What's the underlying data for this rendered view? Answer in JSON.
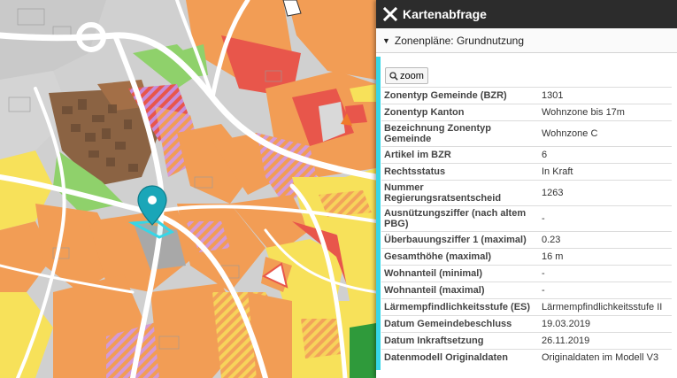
{
  "panel": {
    "title": "Kartenabfrage",
    "section_label": "Zonenpläne: Grundnutzung",
    "zoom_label": "zoom"
  },
  "attributes": [
    {
      "key": "Zonentyp Gemeinde (BZR)",
      "value": "1301"
    },
    {
      "key": "Zonentyp Kanton",
      "value": "Wohnzone bis 17m"
    },
    {
      "key": "Bezeichnung Zonentyp Gemeinde",
      "value": "Wohnzone C"
    },
    {
      "key": "Artikel im BZR",
      "value": "6"
    },
    {
      "key": "Rechtsstatus",
      "value": "In Kraft"
    },
    {
      "key": "Nummer Regierungsratsentscheid",
      "value": "1263"
    },
    {
      "key": "Ausnützungsziffer (nach altem PBG)",
      "value": "-"
    },
    {
      "key": "Überbauungsziffer 1 (maximal)",
      "value": "0.23"
    },
    {
      "key": "Gesamthöhe (maximal)",
      "value": "16 m"
    },
    {
      "key": "Wohnanteil (minimal)",
      "value": "-"
    },
    {
      "key": "Wohnanteil (maximal)",
      "value": "-"
    },
    {
      "key": "Lärmempfindlichkeitsstufe (ES)",
      "value": "Lärmempfindlichkeitsstufe II"
    },
    {
      "key": "Datum Gemeindebeschluss",
      "value": "19.03.2019"
    },
    {
      "key": "Datum Inkraftsetzung",
      "value": "26.11.2019"
    },
    {
      "key": "Datenmodell Originaldaten",
      "value": "Originaldaten im Modell V3"
    }
  ],
  "colors": {
    "header_bg": "#2c2c2c",
    "accent": "#36d6e7",
    "zone_orange": "#f29d55",
    "zone_yellow": "#f7e15a",
    "zone_red": "#e8564b",
    "zone_brown": "#8b6343",
    "zone_green": "#8fd16b",
    "zone_purple": "#c78bd9",
    "road": "#ffffff",
    "marker": "#1aa6b8"
  },
  "icons": {
    "close": "close-icon",
    "caret": "caret-down-icon",
    "zoom": "search-icon",
    "marker": "map-pin-icon"
  }
}
